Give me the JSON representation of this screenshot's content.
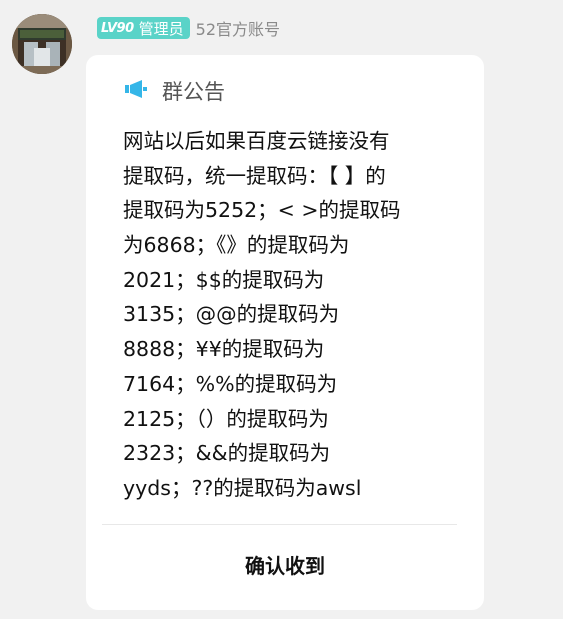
{
  "sender": {
    "level_badge": "LV90",
    "role": "管理员",
    "account_name": "52官方账号"
  },
  "announcement": {
    "title": "群公告",
    "lines": [
      "网站以后如果百度云链接没有",
      "提取码，统一提取码：【 】的",
      "提取码为5252；< >的提取码",
      "为6868；《》的提取码为",
      "2021；$$的提取码为",
      "3135；@@的提取码为",
      "8888；¥¥的提取码为",
      "7164；%%的提取码为",
      "2125；（）的提取码为",
      "2323；&&的提取码为",
      "yyds；??的提取码为awsl"
    ],
    "confirm_label": "确认收到"
  },
  "colors": {
    "badge_bg": "#5ad3c8",
    "megaphone": "#35b6e8",
    "page_bg": "#f1f1f1"
  },
  "icons": [
    "avatar",
    "megaphone-icon"
  ]
}
